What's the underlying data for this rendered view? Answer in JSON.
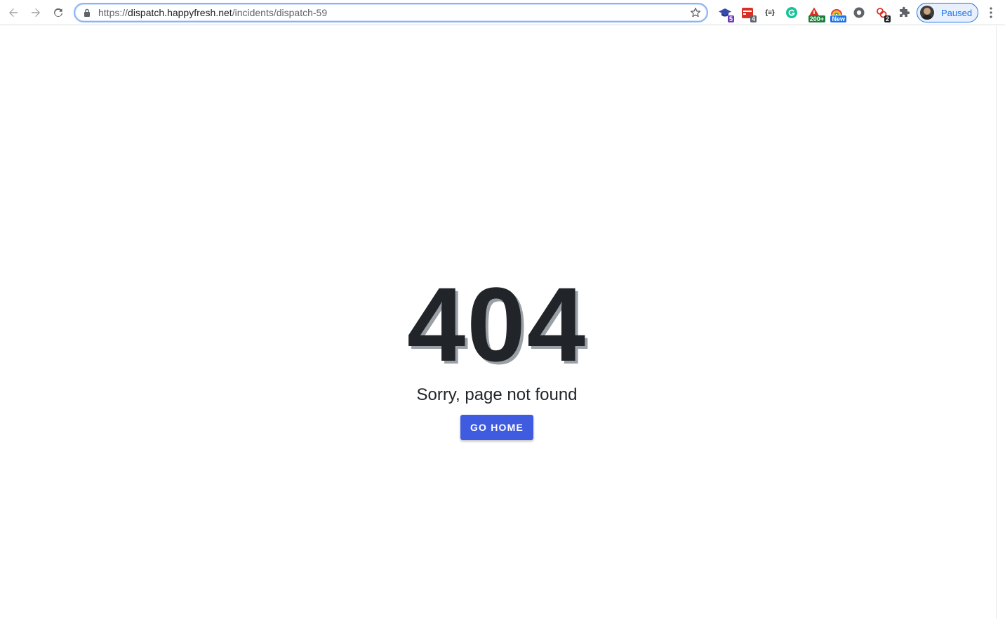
{
  "browser": {
    "url_scheme": "https://",
    "url_host": "dispatch.happyfresh.net",
    "url_path": "/incidents/dispatch-59",
    "extensions": [
      {
        "name": "extension-graduation-icon",
        "badge": "5",
        "badge_color": "#673ab7"
      },
      {
        "name": "extension-calendar-icon",
        "badge": "4",
        "badge_color": "#5f6368"
      },
      {
        "name": "extension-json-icon",
        "label": "{≡}"
      },
      {
        "name": "extension-grammarly-icon"
      },
      {
        "name": "extension-alert-icon",
        "badge": "200+",
        "badge_color": "#188038"
      },
      {
        "name": "extension-rainbow-icon",
        "badge": "New",
        "badge_color": "#1a73e8"
      },
      {
        "name": "extension-circle-icon"
      },
      {
        "name": "extension-link-icon",
        "badge": "2",
        "badge_color": "#202124"
      }
    ],
    "profile_label": "Paused"
  },
  "page": {
    "error_code": "404",
    "message": "Sorry, page not found",
    "home_button": "GO HOME",
    "button_color": "#3f5ce0",
    "text_color": "#212529"
  }
}
